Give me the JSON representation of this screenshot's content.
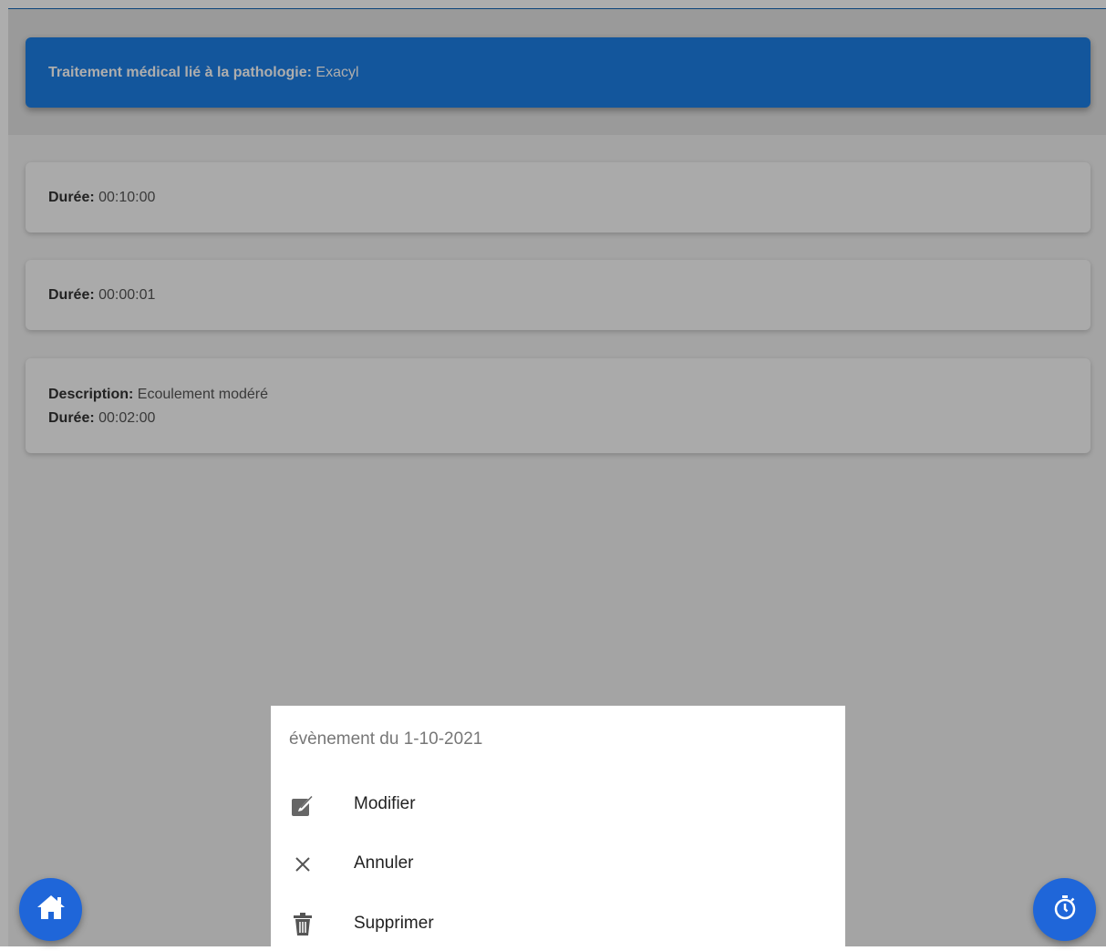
{
  "treatment": {
    "label": "Traitement médical lié à la pathologie:",
    "value": "Exacyl"
  },
  "events": [
    {
      "duration_label": "Durée:",
      "duration_value": "00:10:00"
    },
    {
      "duration_label": "Durée:",
      "duration_value": "00:00:01"
    },
    {
      "description_label": "Description:",
      "description_value": "Ecoulement modéré",
      "duration_label": "Durée:",
      "duration_value": "00:02:00"
    }
  ],
  "action_sheet": {
    "title": "évènement du 1-10-2021",
    "items": [
      {
        "label": "Modifier",
        "icon": "edit-icon"
      },
      {
        "label": "Annuler",
        "icon": "close-icon"
      },
      {
        "label": "Supprimer",
        "icon": "trash-icon"
      }
    ]
  },
  "fabs": {
    "home_icon": "home-icon",
    "timer_icon": "stopwatch-icon"
  },
  "colors": {
    "primary": "#1d7fe6",
    "fab": "#1f66d9",
    "overlay": "rgba(0,0,0,0.32)"
  }
}
